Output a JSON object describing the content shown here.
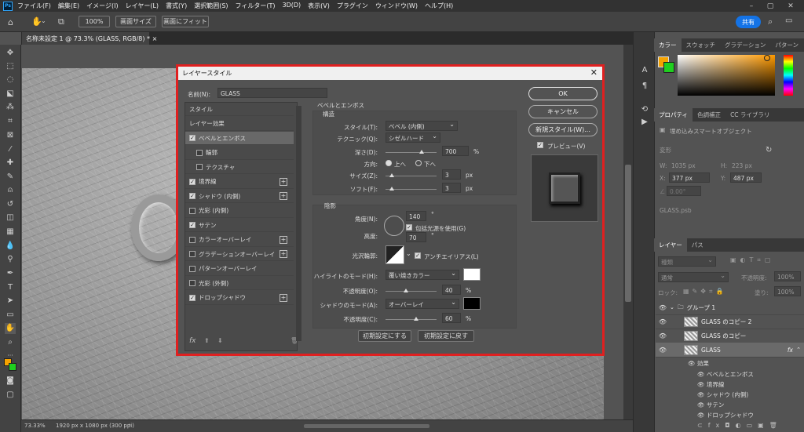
{
  "menubar": {
    "items": [
      "ファイル(F)",
      "編集(E)",
      "イメージ(I)",
      "レイヤー(L)",
      "書式(Y)",
      "選択範囲(S)",
      "フィルター(T)",
      "3D(D)",
      "表示(V)",
      "プラグイン",
      "ウィンドウ(W)",
      "ヘルプ(H)"
    ]
  },
  "options": {
    "zoom": "100%",
    "fit_screen": "画面サイズ",
    "fill_screen": "画面にフィット",
    "share": "共有"
  },
  "document": {
    "tab": "名称未設定 1 @ 73.3% (GLASS, RGB/8) *",
    "zoom": "73.33%",
    "info": "1920 px x 1080 px (300 ppi)"
  },
  "panels": {
    "top_tabs": [
      "カラー",
      "スウォッチ",
      "グラデーション",
      "パターン"
    ],
    "prop_tabs": [
      "プロパティ",
      "色調補正",
      "CC ライブラリ"
    ],
    "prop_type": "埋め込みスマートオブジェクト",
    "transform": "変形",
    "w_label": "W:",
    "w": "1035 px",
    "h_label": "H:",
    "h": "223 px",
    "x_label": "X:",
    "x": "377 px",
    "y_label": "Y:",
    "y": "487 px",
    "angle": "0.00°",
    "file": "GLASS.psb",
    "layer_tabs": [
      "レイヤー",
      "パス"
    ],
    "kind": "種類",
    "blend": "通常",
    "opacity_label": "不透明度:",
    "opacity": "100%",
    "lock_label": "ロック:",
    "fill_label": "塗り:",
    "fill": "100%",
    "layers": [
      {
        "name": "グループ 1"
      },
      {
        "name": "GLASS のコピー 2"
      },
      {
        "name": "GLASS のコピー"
      },
      {
        "name": "GLASS"
      }
    ],
    "effects_label": "効果",
    "effects": [
      "ベベルとエンボス",
      "境界線",
      "シャドウ (内側)",
      "サテン",
      "ドロップシャドウ"
    ]
  },
  "dialog": {
    "title": "レイヤースタイル",
    "name_label": "名前(N):",
    "name_value": "GLASS",
    "styles": [
      {
        "label": "スタイル",
        "cb": null,
        "plus": false
      },
      {
        "label": "レイヤー効果",
        "cb": null,
        "plus": false
      },
      {
        "label": "ベベルとエンボス",
        "cb": true,
        "plus": false,
        "sel": true
      },
      {
        "label": "輪郭",
        "cb": false,
        "plus": false,
        "indent": true
      },
      {
        "label": "テクスチャ",
        "cb": false,
        "plus": false,
        "indent": true
      },
      {
        "label": "境界線",
        "cb": true,
        "plus": true
      },
      {
        "label": "シャドウ (内側)",
        "cb": true,
        "plus": true
      },
      {
        "label": "光彩 (内側)",
        "cb": false,
        "plus": false
      },
      {
        "label": "サテン",
        "cb": true,
        "plus": false
      },
      {
        "label": "カラーオーバーレイ",
        "cb": false,
        "plus": true
      },
      {
        "label": "グラデーションオーバーレイ",
        "cb": false,
        "plus": true
      },
      {
        "label": "パターンオーバーレイ",
        "cb": false,
        "plus": false
      },
      {
        "label": "光彩 (外側)",
        "cb": false,
        "plus": false
      },
      {
        "label": "ドロップシャドウ",
        "cb": true,
        "plus": true
      }
    ],
    "fx": "fx",
    "section": "ベベルとエンボス",
    "structure": "構造",
    "style_label": "スタイル(T):",
    "style_value": "ベベル (内側)",
    "technique_label": "テクニック(Q):",
    "technique_value": "シゼルハード",
    "depth_label": "深さ(D):",
    "depth": "700",
    "pct": "%",
    "direction_label": "方向:",
    "up": "上へ",
    "down": "下へ",
    "size_label": "サイズ(Z):",
    "size": "3",
    "px": "px",
    "soften_label": "ソフト(F):",
    "soften": "3",
    "shading": "陰影",
    "angle_label": "角度(N):",
    "angle": "140",
    "deg": "°",
    "global_light": "包括光源を使用(G)",
    "altitude_label": "高度:",
    "altitude": "70",
    "gloss_label": "光沢輪郭:",
    "antialias": "アンチエイリアス(L)",
    "hl_mode_label": "ハイライトのモード(H):",
    "hl_mode": "覆い焼きカラー",
    "hl_op_label": "不透明度(O):",
    "hl_op": "40",
    "sh_mode_label": "シャドウのモード(A):",
    "sh_mode": "オーバーレイ",
    "sh_op_label": "不透明度(C):",
    "sh_op": "60",
    "reset_default": "初期設定にする",
    "restore_default": "初期設定に戻す",
    "ok": "OK",
    "cancel": "キャンセル",
    "new_style": "新規スタイル(W)...",
    "preview": "プレビュー(V)"
  },
  "colors": {
    "fg": "#f5a300",
    "bg": "#1fcf1f",
    "accent": "#1473e6",
    "dialog_border": "#e02020"
  },
  "slider_values": {
    "depth": 0.7,
    "size": 0.12,
    "soften": 0.12,
    "hl_op": 0.4,
    "sh_op": 0.6
  }
}
